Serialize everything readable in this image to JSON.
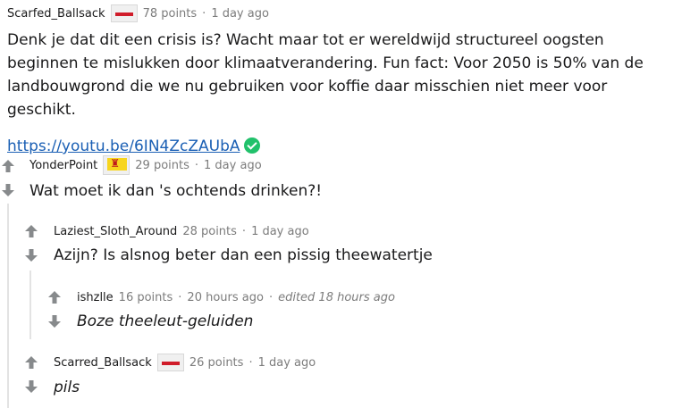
{
  "comments": [
    {
      "author": "Scarfed_Ballsack",
      "points": "78 points",
      "time": "1 day ago",
      "flair": "red-stripe",
      "body": "Denk je dat dit een crisis is? Wacht maar tot er wereldwijd structureel oogsten beginnen te mislukken door klimaatverandering. Fun fact: Voor 2050 is 50% van de landbouwgrond die we nu gebruiken voor koffie daar misschien niet meer voor geschikt.",
      "link": "https://youtu.be/6IN4ZcZAUbA"
    },
    {
      "author": "YonderPoint",
      "points": "29 points",
      "time": "1 day ago",
      "flair": "yellow-lion",
      "body": "Wat moet ik dan 's ochtends drinken?!"
    },
    {
      "author": "Laziest_Sloth_Around",
      "points": "28 points",
      "time": "1 day ago",
      "body": "Azijn? Is alsnog beter dan een pissig theewatertje"
    },
    {
      "author": "ishzlle",
      "points": "16 points",
      "time": "20 hours ago",
      "edited": "edited 18 hours ago",
      "body": "Boze theeleut-geluiden"
    },
    {
      "author": "Scarred_Ballsack",
      "points": "26 points",
      "time": "1 day ago",
      "flair": "red-stripe",
      "body": "pils"
    }
  ],
  "separator": "·"
}
